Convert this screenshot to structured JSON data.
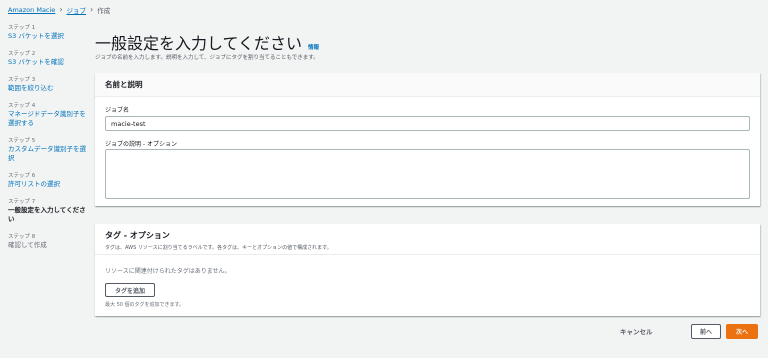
{
  "breadcrumb": {
    "root": "Amazon Macie",
    "jobs": "ジョブ",
    "current": "作成"
  },
  "steps": [
    {
      "num": "ステップ 1",
      "label": "S3 バケットを選択"
    },
    {
      "num": "ステップ 2",
      "label": "S3 バケットを確認"
    },
    {
      "num": "ステップ 3",
      "label": "範囲を絞り込む"
    },
    {
      "num": "ステップ 4",
      "label": "マネージドデータ識別子を選択する"
    },
    {
      "num": "ステップ 5",
      "label": "カスタムデータ識別子を選択"
    },
    {
      "num": "ステップ 6",
      "label": "許可リストの選択"
    },
    {
      "num": "ステップ 7",
      "label": "一般設定を入力してください"
    },
    {
      "num": "ステップ 8",
      "label": "確認して作成"
    }
  ],
  "page": {
    "title": "一般設定を入力してください",
    "info": "情報",
    "description": "ジョブの名前を入力します。説明を入力して、ジョブにタグを割り当てることもできます。"
  },
  "name_section": {
    "title": "名前と説明",
    "job_name_label": "ジョブ名",
    "job_name_value": "macie-test",
    "job_desc_label": "ジョブの説明 - オプション",
    "job_desc_value": ""
  },
  "tags_section": {
    "title": "タグ - オプション",
    "description": "タグは、AWS リソースに割り当てるラベルです。各タグは、キーとオプションの値で構成されます。",
    "empty": "リソースに関連付けられたタグはありません。",
    "add_button": "タグを追加",
    "limit": "最大 50 個のタグを追加できます。"
  },
  "footer": {
    "cancel": "キャンセル",
    "prev": "前へ",
    "next": "次へ"
  },
  "colors": {
    "link": "#0073bb",
    "primary": "#ec7211",
    "background": "#f2f3f3"
  }
}
